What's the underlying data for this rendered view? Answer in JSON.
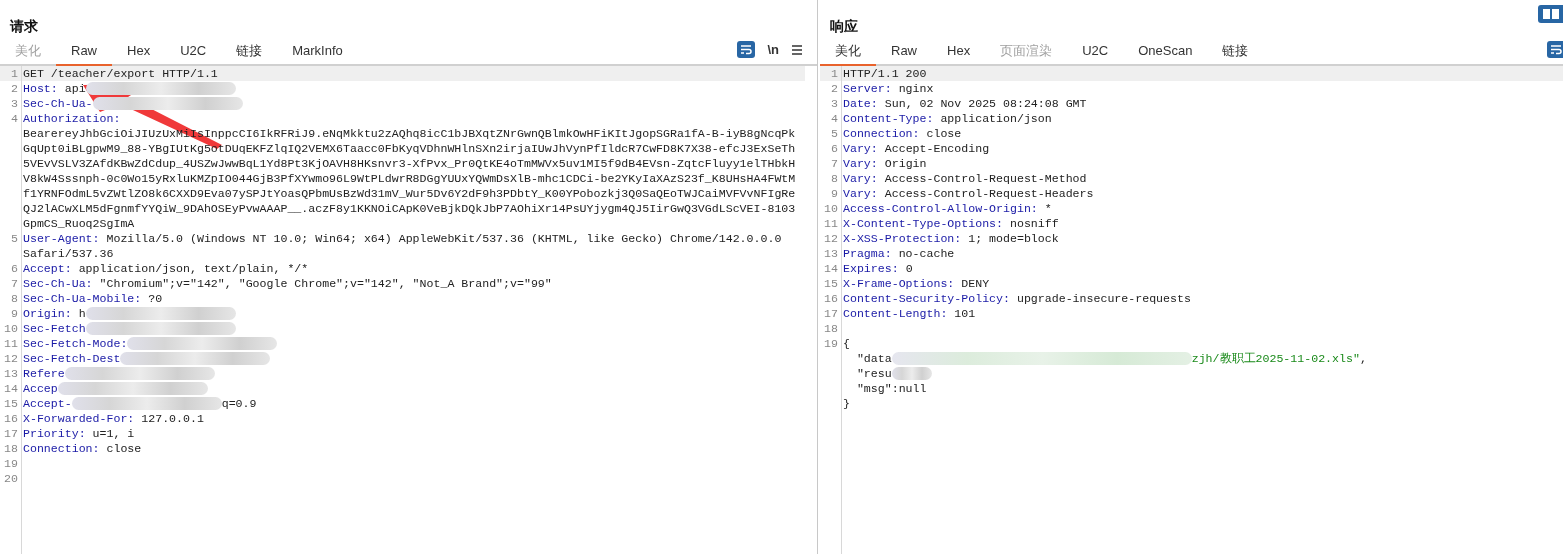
{
  "request": {
    "title": "请求",
    "tabs": [
      {
        "label": "美化",
        "selected": false,
        "disabled": true
      },
      {
        "label": "Raw",
        "selected": true,
        "disabled": false
      },
      {
        "label": "Hex",
        "selected": false,
        "disabled": false
      },
      {
        "label": "U2C",
        "selected": false,
        "disabled": false
      },
      {
        "label": "链接",
        "selected": false,
        "disabled": false
      },
      {
        "label": "MarkInfo",
        "selected": false,
        "disabled": false
      }
    ],
    "newline_toggle": "\\n",
    "lines": [
      {
        "number": "1",
        "highlighted": true,
        "segments": [
          {
            "kind": "plain",
            "text": "GET /teacher/export HTTP/1.1"
          }
        ]
      },
      {
        "number": "2",
        "highlighted": false,
        "segments": [
          {
            "kind": "key",
            "text": "Host:"
          },
          {
            "kind": "plain",
            "text": " api"
          },
          {
            "kind": "redaction"
          }
        ]
      },
      {
        "number": "3",
        "highlighted": false,
        "segments": [
          {
            "kind": "key",
            "text": "Sec-Ch-Ua-"
          },
          {
            "kind": "redaction"
          }
        ]
      },
      {
        "number": "4",
        "highlighted": false,
        "segments": [
          {
            "kind": "key",
            "text": "Authorization:"
          }
        ]
      },
      {
        "highlighted": false,
        "segments": [
          {
            "kind": "plain",
            "text": "BearereyJhbGciOiJIUzUxMiIsInppcCI6IkRFRiJ9.eNqMkktu2zAQhq8icC1bJBXqtZNrGwnQBlmkOwHFiKItJgopSGRa1fA-B-iyB8gNcqPk"
          }
        ]
      },
      {
        "highlighted": false,
        "segments": [
          {
            "kind": "plain",
            "text": "GqUpt0iBLgpwM9_88-YBgIUtKg5otDUqEKFZlqIQ2VEMX6Taacc0FbKyqVDhnWHlnSXn2irjaIUwJhVynPfIldcR7CwFD8K7X38-efcJ3ExSeTh"
          }
        ]
      },
      {
        "highlighted": false,
        "segments": [
          {
            "kind": "plain",
            "text": "5VEvVSLV3ZAfdKBwZdCdup_4USZwJwwBqL1Yd8Pt3KjOAVH8HKsnvr3-XfPvx_Pr0QtKE4oTmMWVx5uv1MI5f9dB4EVsn-ZqtcFluyy1elTHbkH"
          }
        ]
      },
      {
        "highlighted": false,
        "segments": [
          {
            "kind": "plain",
            "text": "V8kW4Sssnph-0c0Wo15yRxluKMZpIO044GjB3PfXYwmo96L9WtPLdwrR8DGgYUUxYQWmDsXlB-mhc1CDCi-be2YKyIaXAzS23f_K8UHsHA4FWtM"
          }
        ]
      },
      {
        "highlighted": false,
        "segments": [
          {
            "kind": "plain",
            "text": "f1YRNFOdmL5vZWtlZO8k6CXXD9Eva07ySPJtYoasQPbmUsBzWd31mV_Wur5Dv6Y2dF9h3PDbtY_K00YPobozkj3Q0SaQEoTWJCaiMVFVvNFIgRe"
          }
        ]
      },
      {
        "highlighted": false,
        "segments": [
          {
            "kind": "plain",
            "text": "QJ2lACwXLM5dFgnmfYYQiW_9DAhOSEyPvwAAAP__.aczF8y1KKNOiCApK0VeBjkDQkJbP7AOhiXr14PsUYjygm4QJ5IirGwQ3VGdLScVEI-8103"
          }
        ]
      },
      {
        "highlighted": false,
        "segments": [
          {
            "kind": "plain",
            "text": "GpmCS_Ruoq2SgImA"
          }
        ]
      },
      {
        "number": "5",
        "highlighted": false,
        "segments": [
          {
            "kind": "key",
            "text": "User-Agent:"
          },
          {
            "kind": "plain",
            "text": " Mozilla/5.0 (Windows NT 10.0; Win64; x64) AppleWebKit/537.36 (KHTML, like Gecko) Chrome/142.0.0.0"
          }
        ]
      },
      {
        "highlighted": false,
        "segments": [
          {
            "kind": "plain",
            "text": "Safari/537.36"
          }
        ]
      },
      {
        "number": "6",
        "highlighted": false,
        "segments": [
          {
            "kind": "key",
            "text": "Accept:"
          },
          {
            "kind": "plain",
            "text": " application/json, text/plain, */*"
          }
        ]
      },
      {
        "number": "7",
        "highlighted": false,
        "segments": [
          {
            "kind": "key",
            "text": "Sec-Ch-Ua:"
          },
          {
            "kind": "plain",
            "text": " \"Chromium\";v=\"142\", \"Google Chrome\";v=\"142\", \"Not_A Brand\";v=\"99\""
          }
        ]
      },
      {
        "number": "8",
        "highlighted": false,
        "segments": [
          {
            "kind": "key",
            "text": "Sec-Ch-Ua-Mobile:"
          },
          {
            "kind": "plain",
            "text": " ?0"
          }
        ]
      },
      {
        "number": "9",
        "highlighted": false,
        "segments": [
          {
            "kind": "key",
            "text": "Origin:"
          },
          {
            "kind": "plain",
            "text": " h"
          },
          {
            "kind": "redaction"
          }
        ]
      },
      {
        "number": "10",
        "highlighted": false,
        "segments": [
          {
            "kind": "key",
            "text": "Sec-Fetch"
          },
          {
            "kind": "redaction"
          }
        ]
      },
      {
        "number": "11",
        "highlighted": false,
        "segments": [
          {
            "kind": "key",
            "text": "Sec-Fetch-Mode:"
          },
          {
            "kind": "redaction"
          }
        ]
      },
      {
        "number": "12",
        "highlighted": false,
        "segments": [
          {
            "kind": "key",
            "text": "Sec-Fetch-Dest"
          },
          {
            "kind": "redaction"
          }
        ]
      },
      {
        "number": "13",
        "highlighted": false,
        "segments": [
          {
            "kind": "key",
            "text": "Refere"
          },
          {
            "kind": "redaction"
          }
        ]
      },
      {
        "number": "14",
        "highlighted": false,
        "segments": [
          {
            "kind": "key",
            "text": "Accep"
          },
          {
            "kind": "redaction"
          }
        ]
      },
      {
        "number": "15",
        "highlighted": false,
        "segments": [
          {
            "kind": "key",
            "text": "Accept-"
          },
          {
            "kind": "redaction"
          },
          {
            "kind": "plain",
            "text": "q=0.9"
          }
        ]
      },
      {
        "number": "16",
        "highlighted": false,
        "segments": [
          {
            "kind": "key",
            "text": "X-Forwarded-For:"
          },
          {
            "kind": "plain",
            "text": " 127.0.0.1"
          }
        ]
      },
      {
        "number": "17",
        "highlighted": false,
        "segments": [
          {
            "kind": "key",
            "text": "Priority:"
          },
          {
            "kind": "plain",
            "text": " u=1, i"
          }
        ]
      },
      {
        "number": "18",
        "highlighted": false,
        "segments": [
          {
            "kind": "key",
            "text": "Connection:"
          },
          {
            "kind": "plain",
            "text": " close"
          }
        ]
      },
      {
        "number": "19",
        "highlighted": false
      },
      {
        "number": "20",
        "highlighted": false
      }
    ]
  },
  "response": {
    "title": "响应",
    "tabs": [
      {
        "label": "美化",
        "selected": true,
        "disabled": false
      },
      {
        "label": "Raw",
        "selected": false,
        "disabled": false
      },
      {
        "label": "Hex",
        "selected": false,
        "disabled": false
      },
      {
        "label": "页面渲染",
        "selected": false,
        "disabled": true
      },
      {
        "label": "U2C",
        "selected": false,
        "disabled": false
      },
      {
        "label": "OneScan",
        "selected": false,
        "disabled": false
      },
      {
        "label": "链接",
        "selected": false,
        "disabled": false
      }
    ],
    "lines": [
      {
        "number": "1",
        "highlighted": true,
        "segments": [
          {
            "kind": "plain",
            "text": "HTTP/1.1 200"
          }
        ]
      },
      {
        "number": "2",
        "highlighted": false,
        "segments": [
          {
            "kind": "key",
            "text": "Server:"
          },
          {
            "kind": "plain",
            "text": " nginx"
          }
        ]
      },
      {
        "number": "3",
        "highlighted": false,
        "segments": [
          {
            "kind": "key",
            "text": "Date:"
          },
          {
            "kind": "plain",
            "text": " Sun, 02 Nov 2025 08:24:08 GMT"
          }
        ]
      },
      {
        "number": "4",
        "highlighted": false,
        "segments": [
          {
            "kind": "key",
            "text": "Content-Type:"
          },
          {
            "kind": "plain",
            "text": " application/json"
          }
        ]
      },
      {
        "number": "5",
        "highlighted": false,
        "segments": [
          {
            "kind": "key",
            "text": "Connection:"
          },
          {
            "kind": "plain",
            "text": " close"
          }
        ]
      },
      {
        "number": "6",
        "highlighted": false,
        "segments": [
          {
            "kind": "key",
            "text": "Vary:"
          },
          {
            "kind": "plain",
            "text": " Accept-Encoding"
          }
        ]
      },
      {
        "number": "7",
        "highlighted": false,
        "segments": [
          {
            "kind": "key",
            "text": "Vary:"
          },
          {
            "kind": "plain",
            "text": " Origin"
          }
        ]
      },
      {
        "number": "8",
        "highlighted": false,
        "segments": [
          {
            "kind": "key",
            "text": "Vary:"
          },
          {
            "kind": "plain",
            "text": " Access-Control-Request-Method"
          }
        ]
      },
      {
        "number": "9",
        "highlighted": false,
        "segments": [
          {
            "kind": "key",
            "text": "Vary:"
          },
          {
            "kind": "plain",
            "text": " Access-Control-Request-Headers"
          }
        ]
      },
      {
        "number": "10",
        "highlighted": false,
        "segments": [
          {
            "kind": "key",
            "text": "Access-Control-Allow-Origin:"
          },
          {
            "kind": "plain",
            "text": " *"
          }
        ]
      },
      {
        "number": "11",
        "highlighted": false,
        "segments": [
          {
            "kind": "key",
            "text": "X-Content-Type-Options:"
          },
          {
            "kind": "plain",
            "text": " nosniff"
          }
        ]
      },
      {
        "number": "12",
        "highlighted": false,
        "segments": [
          {
            "kind": "key",
            "text": "X-XSS-Protection:"
          },
          {
            "kind": "plain",
            "text": " 1; mode=block"
          }
        ]
      },
      {
        "number": "13",
        "highlighted": false,
        "segments": [
          {
            "kind": "key",
            "text": "Pragma:"
          },
          {
            "kind": "plain",
            "text": " no-cache"
          }
        ]
      },
      {
        "number": "14",
        "highlighted": false,
        "segments": [
          {
            "kind": "key",
            "text": "Expires:"
          },
          {
            "kind": "plain",
            "text": " 0"
          }
        ]
      },
      {
        "number": "15",
        "highlighted": false,
        "segments": [
          {
            "kind": "key",
            "text": "X-Frame-Options:"
          },
          {
            "kind": "plain",
            "text": " DENY"
          }
        ]
      },
      {
        "number": "16",
        "highlighted": false,
        "segments": [
          {
            "kind": "key",
            "text": "Content-Security-Policy:"
          },
          {
            "kind": "plain",
            "text": " upgrade-insecure-requests"
          }
        ]
      },
      {
        "number": "17",
        "highlighted": false,
        "segments": [
          {
            "kind": "key",
            "text": "Content-Length:"
          },
          {
            "kind": "plain",
            "text": " 101"
          }
        ]
      },
      {
        "number": "18",
        "highlighted": false
      },
      {
        "number": "19",
        "highlighted": false,
        "segments": [
          {
            "kind": "plain",
            "text": "{"
          }
        ]
      },
      {
        "highlighted": false,
        "segments": [
          {
            "kind": "plain",
            "text": "  \"data"
          },
          {
            "kind": "redaction-wide"
          },
          {
            "kind": "string",
            "text": "zjh/教职工2025-11-02.xls\""
          },
          {
            "kind": "plain",
            "text": ","
          }
        ]
      },
      {
        "highlighted": false,
        "segments": [
          {
            "kind": "plain",
            "text": "  \"resu"
          },
          {
            "kind": "redaction-small"
          }
        ]
      },
      {
        "highlighted": false,
        "segments": [
          {
            "kind": "plain",
            "text": "  \"msg\":null"
          }
        ]
      },
      {
        "highlighted": false,
        "segments": [
          {
            "kind": "plain",
            "text": "}"
          }
        ]
      }
    ]
  }
}
